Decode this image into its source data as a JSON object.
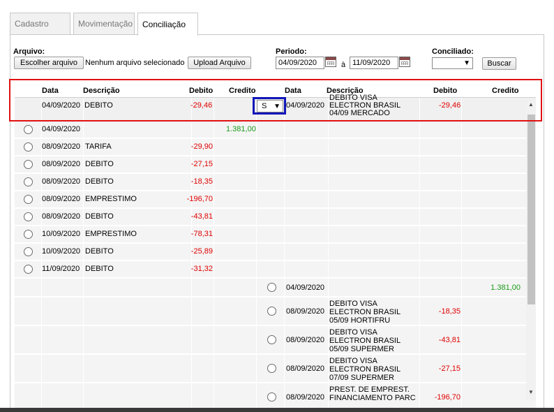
{
  "tabs": [
    "Cadastro",
    "Movimentação",
    "Conciliação"
  ],
  "form": {
    "arquivo_label": "Arquivo:",
    "choose_file": "Escolher arquivo",
    "no_file": "Nenhum arquivo selecionado",
    "upload": "Upload Arquivo",
    "periodo_label": "Periodo:",
    "date_from": "04/09/2020",
    "date_sep": "à",
    "date_to": "11/09/2020",
    "conciliado_label": "Conciliado:",
    "conciliado_value": "",
    "buscar": "Buscar"
  },
  "headers": {
    "left": [
      "Data",
      "Descrição",
      "Debito",
      "Credito"
    ],
    "right": [
      "Data",
      "Descrição",
      "Debito",
      "Credito"
    ]
  },
  "first_row": {
    "l_date": "04/09/2020",
    "l_desc": "DEBITO",
    "l_debit": "-29,46",
    "select": "S",
    "r_date": "04/09/2020",
    "r_desc": [
      "DEBITO VISA",
      "ELECTRON BRASIL",
      "04/09 MERCADO"
    ],
    "r_debit": "-29,46"
  },
  "left_rows": [
    {
      "date": "04/09/2020",
      "desc": "",
      "debit": "",
      "credit": "1.381,00"
    },
    {
      "date": "08/09/2020",
      "desc": "TARIFA",
      "debit": "-29,90",
      "credit": ""
    },
    {
      "date": "08/09/2020",
      "desc": "DEBITO",
      "debit": "-27,15",
      "credit": ""
    },
    {
      "date": "08/09/2020",
      "desc": "DEBITO",
      "debit": "-18,35",
      "credit": ""
    },
    {
      "date": "08/09/2020",
      "desc": "EMPRESTIMO",
      "debit": "-196,70",
      "credit": ""
    },
    {
      "date": "08/09/2020",
      "desc": "DEBITO",
      "debit": "-43,81",
      "credit": ""
    },
    {
      "date": "10/09/2020",
      "desc": "EMPRESTIMO",
      "debit": "-78,31",
      "credit": ""
    },
    {
      "date": "10/09/2020",
      "desc": "DEBITO",
      "debit": "-25,89",
      "credit": ""
    },
    {
      "date": "11/09/2020",
      "desc": "DEBITO",
      "debit": "-31,32",
      "credit": ""
    }
  ],
  "right_rows": [
    {
      "date": "04/09/2020",
      "desc": [],
      "debit": "",
      "credit": "1.381,00"
    },
    {
      "date": "08/09/2020",
      "desc": [
        "DEBITO VISA",
        "ELECTRON BRASIL",
        "05/09 HORTIFRU"
      ],
      "debit": "-18,35",
      "credit": ""
    },
    {
      "date": "08/09/2020",
      "desc": [
        "DEBITO VISA",
        "ELECTRON BRASIL",
        "05/09 SUPERMER"
      ],
      "debit": "-43,81",
      "credit": ""
    },
    {
      "date": "08/09/2020",
      "desc": [
        "DEBITO VISA",
        "ELECTRON BRASIL",
        "07/09 SUPERMER"
      ],
      "debit": "-27,15",
      "credit": ""
    },
    {
      "date": "08/09/2020",
      "desc": [
        "PREST. DE EMPREST.",
        "FINANCIAMENTO PARC"
      ],
      "debit": "-196,70",
      "credit": ""
    }
  ]
}
